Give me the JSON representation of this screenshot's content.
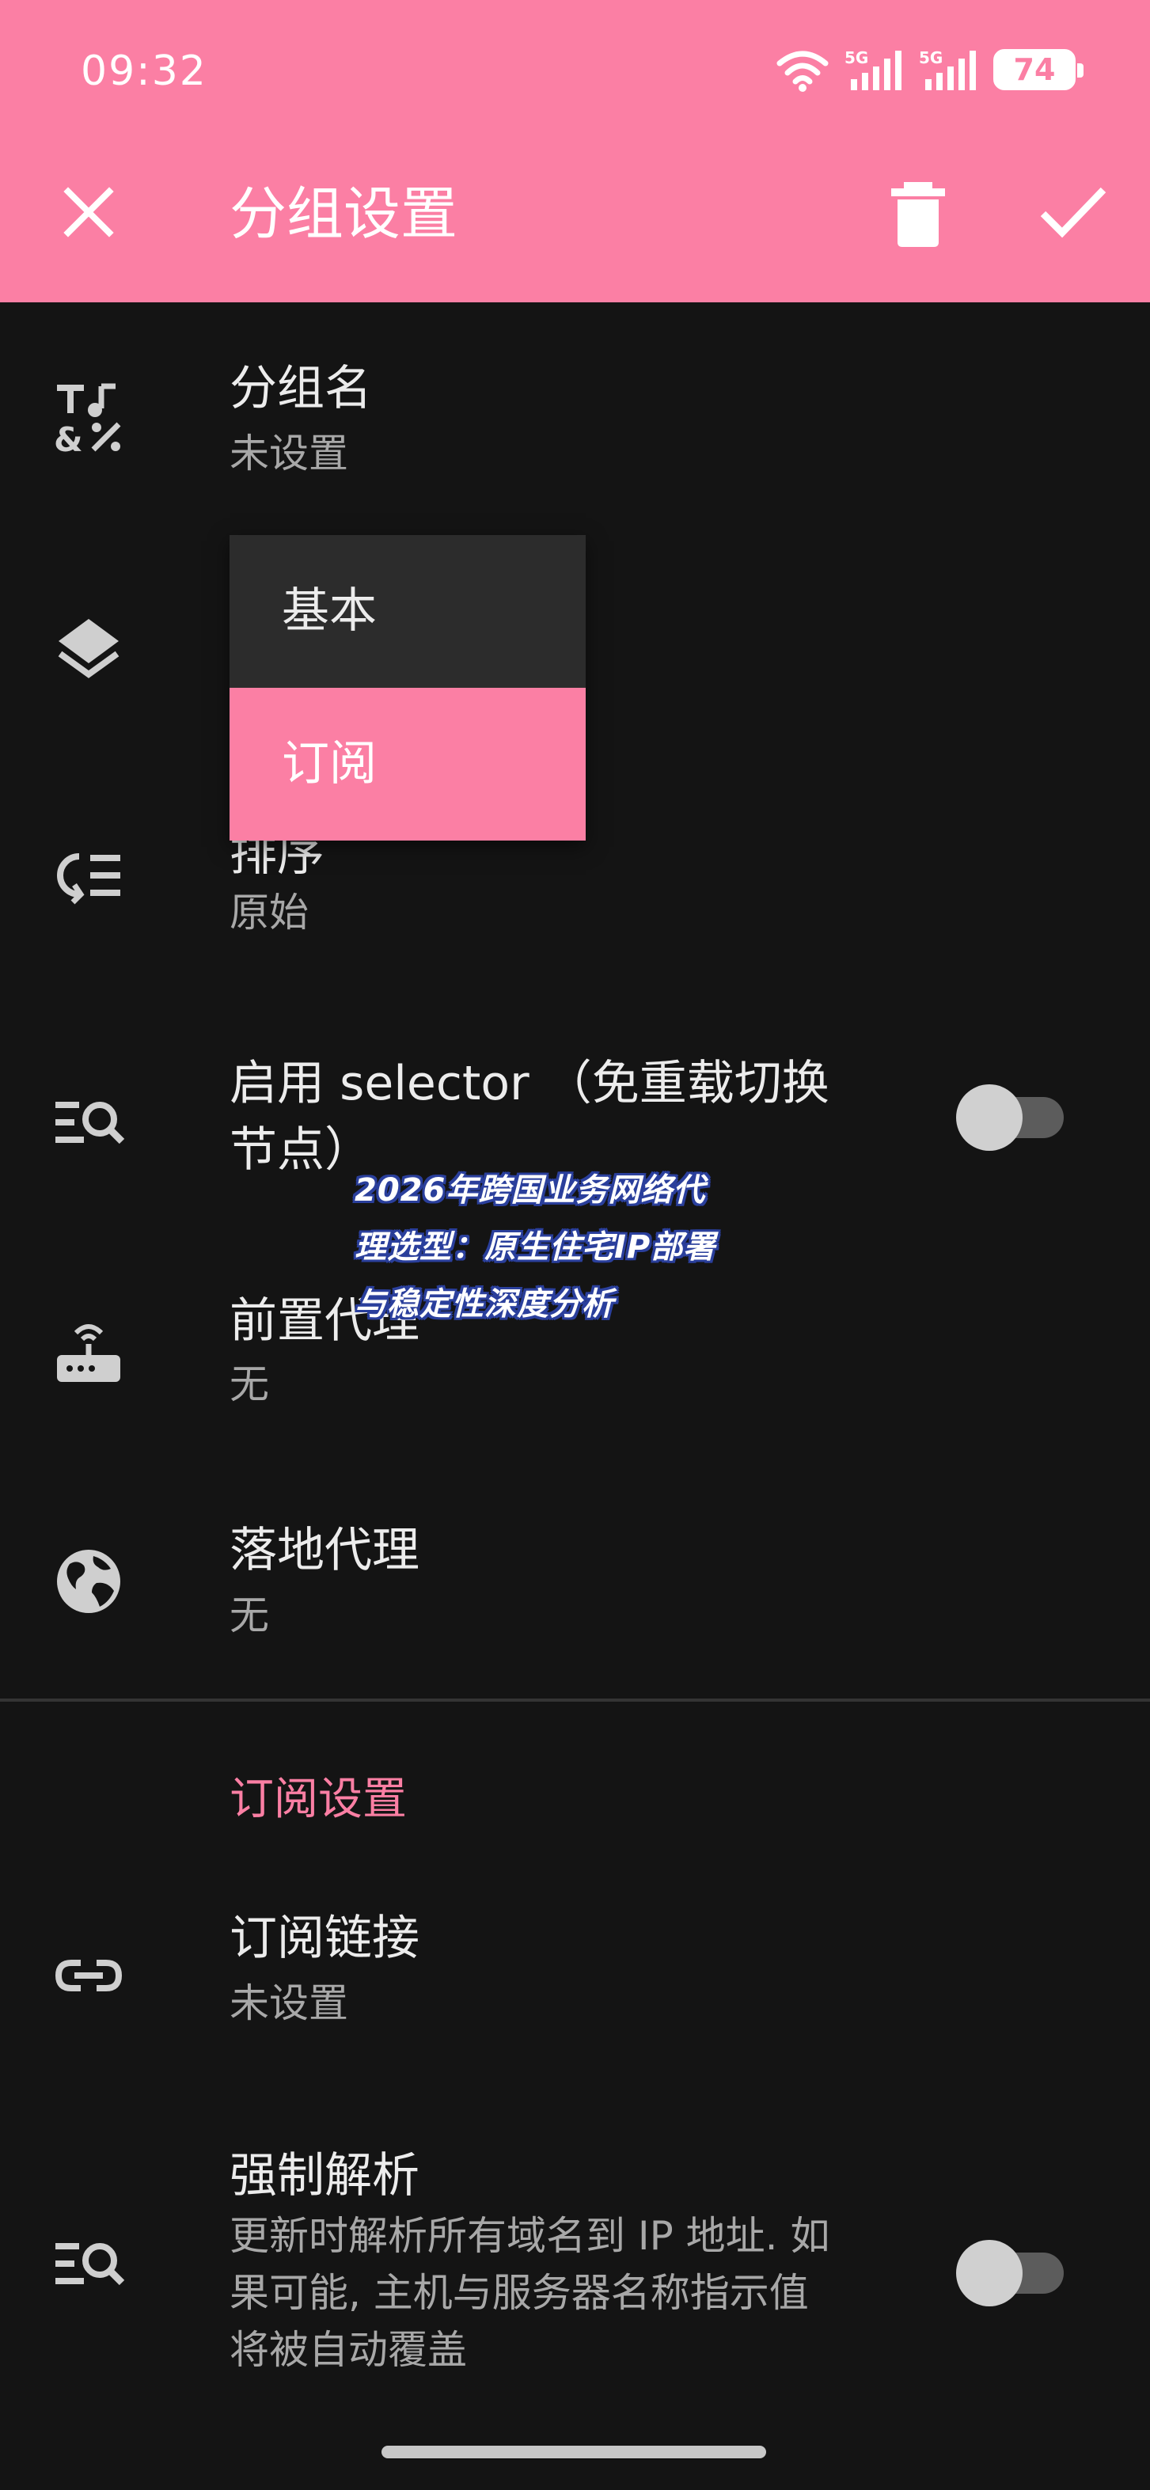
{
  "status_bar": {
    "time": "09:32",
    "battery": "74",
    "wifi_label": "7+",
    "sim1_label": "5G",
    "sim2_label": "5G"
  },
  "toolbar": {
    "title": "分组设置",
    "close_icon": "close-icon",
    "delete_icon": "trash-icon",
    "done_icon": "check-icon"
  },
  "rows": {
    "group_name": {
      "title": "分组名",
      "subtitle": "未设置",
      "icon": "text-format-icon"
    },
    "type": {
      "icon": "layers-icon"
    },
    "sort": {
      "title": "排序",
      "subtitle": "原始",
      "icon": "sort-icon"
    },
    "selector": {
      "title_line1": "启用 selector （免重载切换",
      "title_line2": "节点）",
      "icon": "list-search-icon",
      "enabled": false
    },
    "front_proxy": {
      "title": "前置代理",
      "subtitle": "无",
      "icon": "router-icon"
    },
    "landing_proxy": {
      "title": "落地代理",
      "subtitle": "无",
      "icon": "globe-icon"
    }
  },
  "subscription_section": {
    "header": "订阅设置",
    "link": {
      "title": "订阅链接",
      "subtitle": "未设置",
      "icon": "link-icon"
    },
    "force_resolve": {
      "title": "强制解析",
      "desc_line1": "更新时解析所有域名到 IP 地址. 如",
      "desc_line2": "果可能, 主机与服务器名称指示值",
      "desc_line3": "将被自动覆盖",
      "icon": "list-search-icon",
      "enabled": false
    }
  },
  "dropdown": {
    "options": [
      "基本",
      "订阅"
    ],
    "selected": "订阅"
  },
  "watermark": {
    "line1": "2026年跨国业务网络代",
    "line2": "理选型：原生住宅IP部署",
    "line3": "与稳定性深度分析"
  },
  "colors": {
    "accent": "#fb7fa4",
    "background": "#141414",
    "menu_background": "#2c2c2c"
  }
}
